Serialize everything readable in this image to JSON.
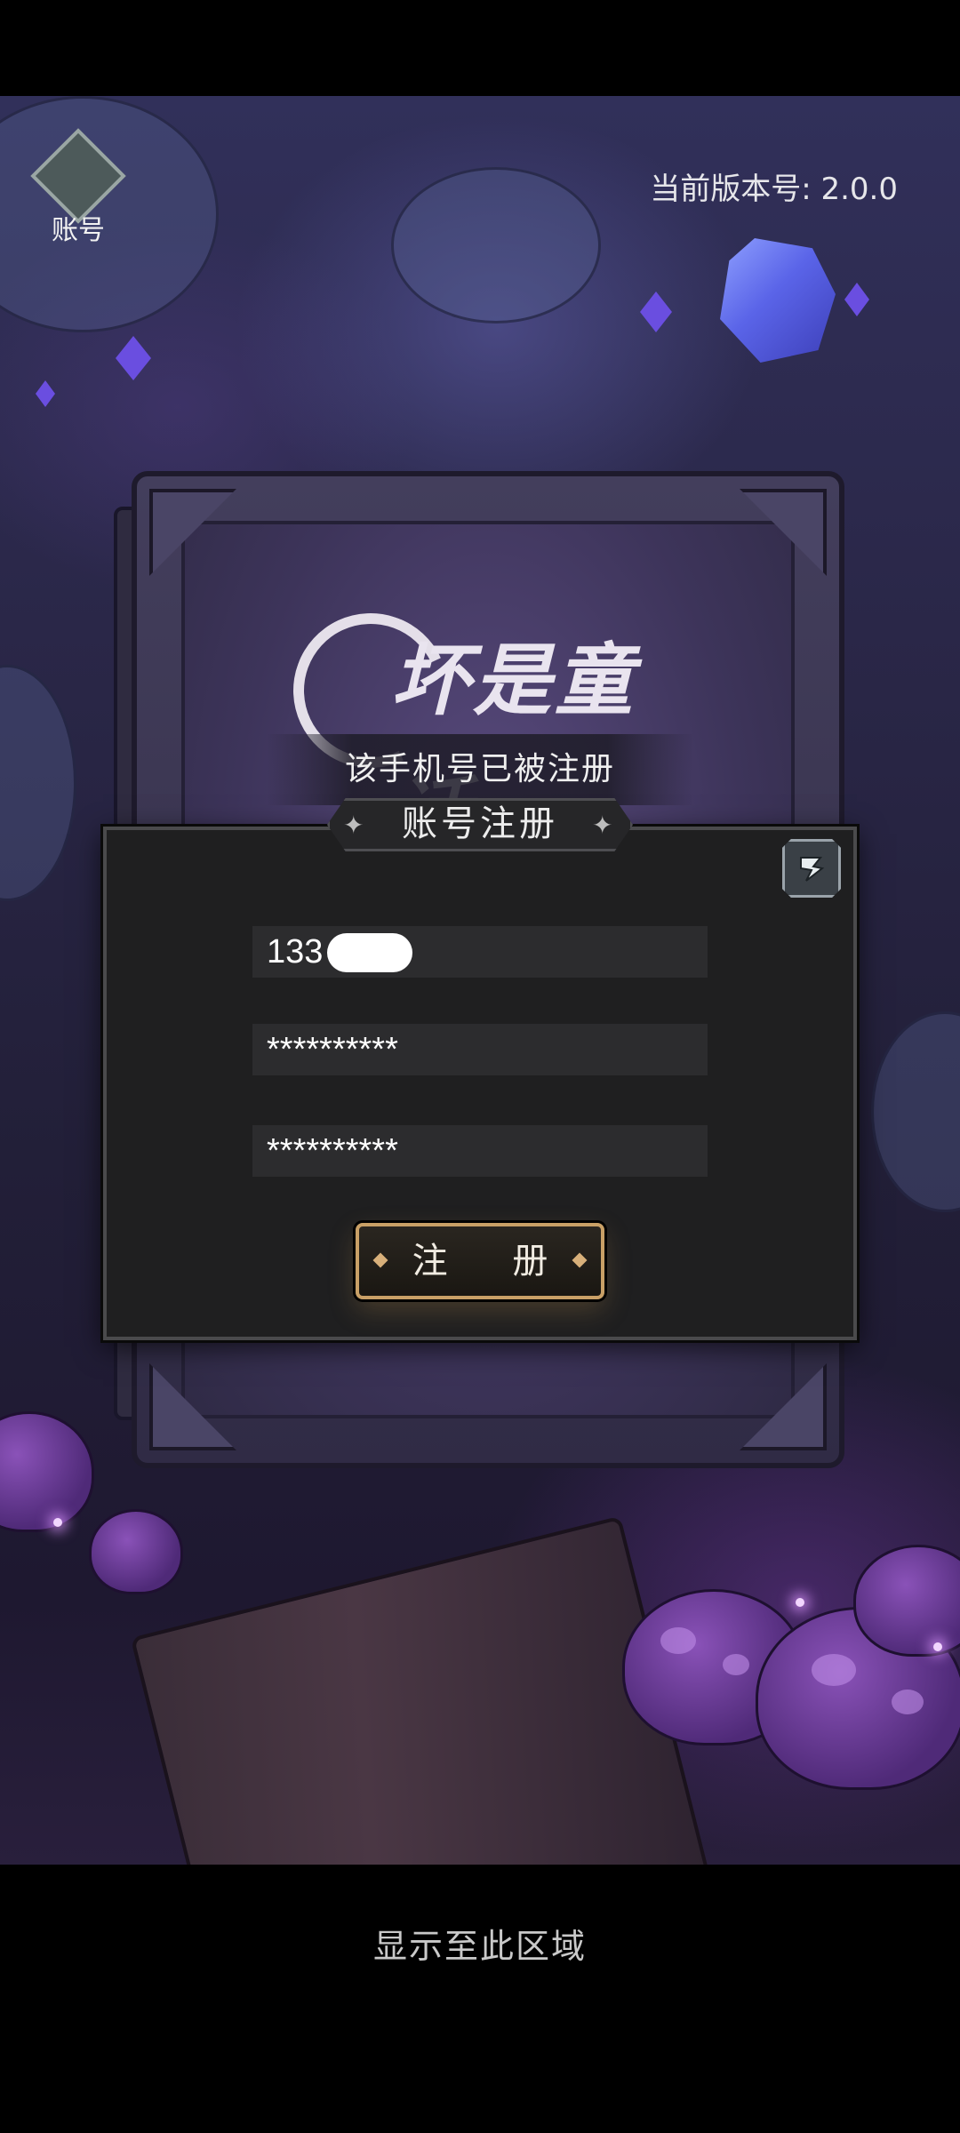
{
  "header": {
    "account_label": "账号",
    "version_text": "当前版本号:  2.0.0"
  },
  "logo": {
    "text": "坏是童话"
  },
  "toast": {
    "message": "该手机号已被注册"
  },
  "dialog": {
    "title": "账号注册",
    "phone_value": "133        4681",
    "password_value": "**********",
    "confirm_password_value": "**********",
    "register_label": "注 册"
  },
  "footer": {
    "text": "显示至此区域"
  },
  "icons": {
    "back": "back-arrow-icon",
    "account": "hooded-figure-icon"
  },
  "colors": {
    "dialog_bg": "#1f1f20",
    "button_border": "#c9a066",
    "field_bg": "#2c2c2e"
  }
}
